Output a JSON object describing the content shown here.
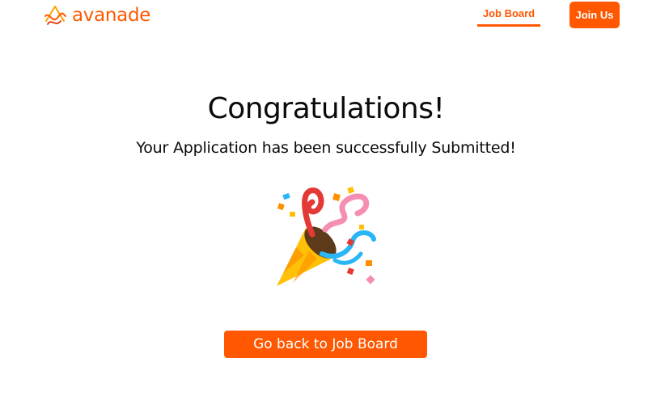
{
  "header": {
    "brand_name": "avanade",
    "nav": {
      "job_board_label": "Job Board",
      "active": "Job Board"
    },
    "join_label": "Join Us"
  },
  "main": {
    "title": "Congratulations!",
    "subtitle": "Your Application has been successfully Submitted!",
    "illustration": "party-popper-icon",
    "back_button_label": "Go back to Job Board"
  },
  "colors": {
    "accent": "#ff5800",
    "text": "#0a0a0a",
    "background": "#ffffff"
  }
}
